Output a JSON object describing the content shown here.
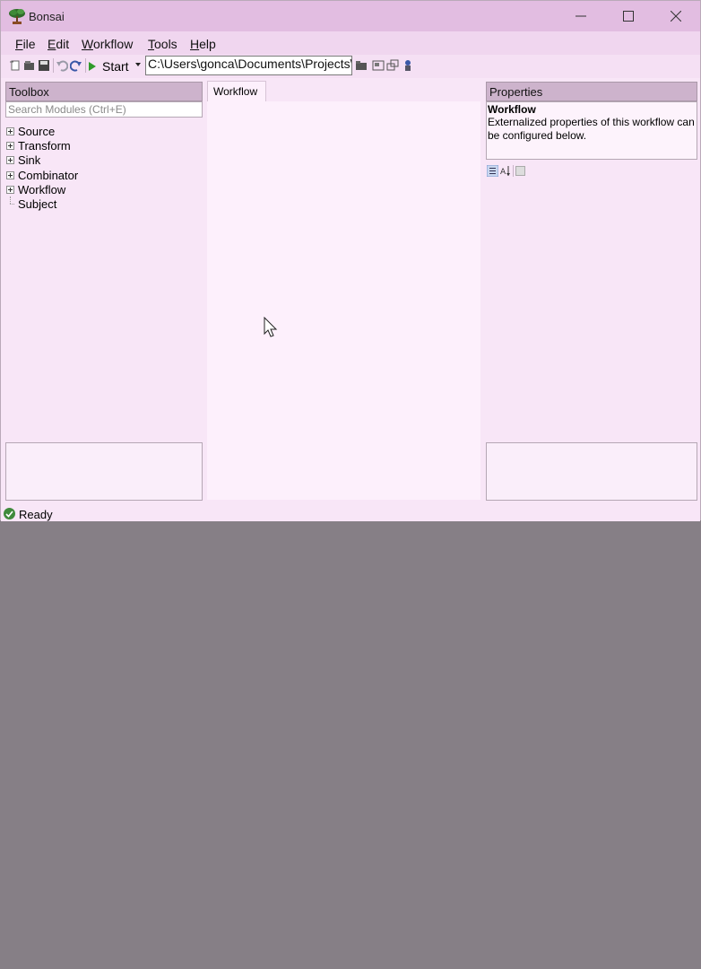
{
  "window": {
    "title": "Bonsai"
  },
  "menu": [
    {
      "label": "File",
      "accel": "F",
      "rest": "ile"
    },
    {
      "label": "Edit",
      "accel": "E",
      "rest": "dit"
    },
    {
      "label": "Workflow",
      "accel": "W",
      "rest": "orkflow"
    },
    {
      "label": "Tools",
      "accel": "T",
      "rest": "ools"
    },
    {
      "label": "Help",
      "accel": "H",
      "rest": "elp"
    }
  ],
  "toolbar": {
    "start_label": "Start",
    "path_value": "C:\\Users\\gonca\\Documents\\Projects\\"
  },
  "toolbox": {
    "title": "Toolbox",
    "search_placeholder": "Search Modules (Ctrl+E)",
    "items": [
      {
        "label": "Source",
        "expandable": true
      },
      {
        "label": "Transform",
        "expandable": true
      },
      {
        "label": "Sink",
        "expandable": true
      },
      {
        "label": "Combinator",
        "expandable": true
      },
      {
        "label": "Workflow",
        "expandable": true
      },
      {
        "label": "Subject",
        "expandable": false
      }
    ]
  },
  "editor": {
    "tab_label": "Workflow"
  },
  "properties": {
    "title": "Properties",
    "desc_title": "Workflow",
    "desc_text": "Externalized properties of this workflow can be configured below."
  },
  "status": {
    "text": "Ready",
    "color": "#3f8a3c"
  }
}
